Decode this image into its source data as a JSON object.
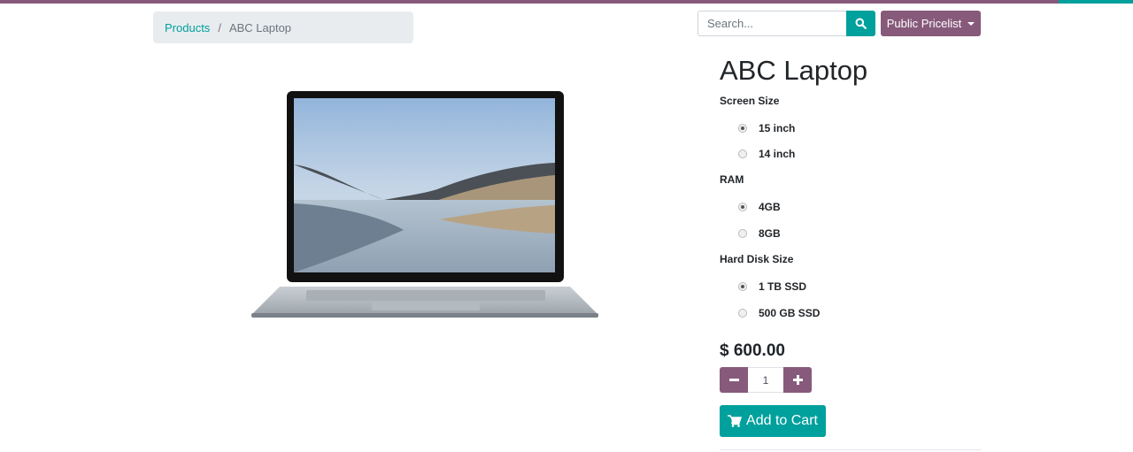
{
  "colors": {
    "primary": "#875a7b",
    "secondary": "#00a09d"
  },
  "breadcrumb": {
    "items": [
      {
        "label": "Products"
      }
    ],
    "separator": "/",
    "current": "ABC Laptop"
  },
  "search": {
    "placeholder": "Search...",
    "value": "",
    "icon": "search-icon"
  },
  "pricelist": {
    "label": "Public Pricelist",
    "icon": "caret-down-icon"
  },
  "product": {
    "name": "ABC Laptop",
    "image_alt": "laptop product image",
    "attributes": [
      {
        "label": "Screen Size",
        "options": [
          {
            "label": "15 inch",
            "checked": true
          },
          {
            "label": "14 inch",
            "checked": false
          }
        ]
      },
      {
        "label": "RAM",
        "options": [
          {
            "label": "4GB",
            "checked": true
          },
          {
            "label": "8GB",
            "checked": false
          }
        ]
      },
      {
        "label": "Hard Disk Size",
        "options": [
          {
            "label": "1 TB SSD",
            "checked": true
          },
          {
            "label": "500 GB SSD",
            "checked": false
          }
        ]
      }
    ],
    "price": "$ 600.00",
    "quantity": "1",
    "add_to_cart_label": "Add to Cart",
    "cart_icon": "shopping-cart-icon"
  }
}
